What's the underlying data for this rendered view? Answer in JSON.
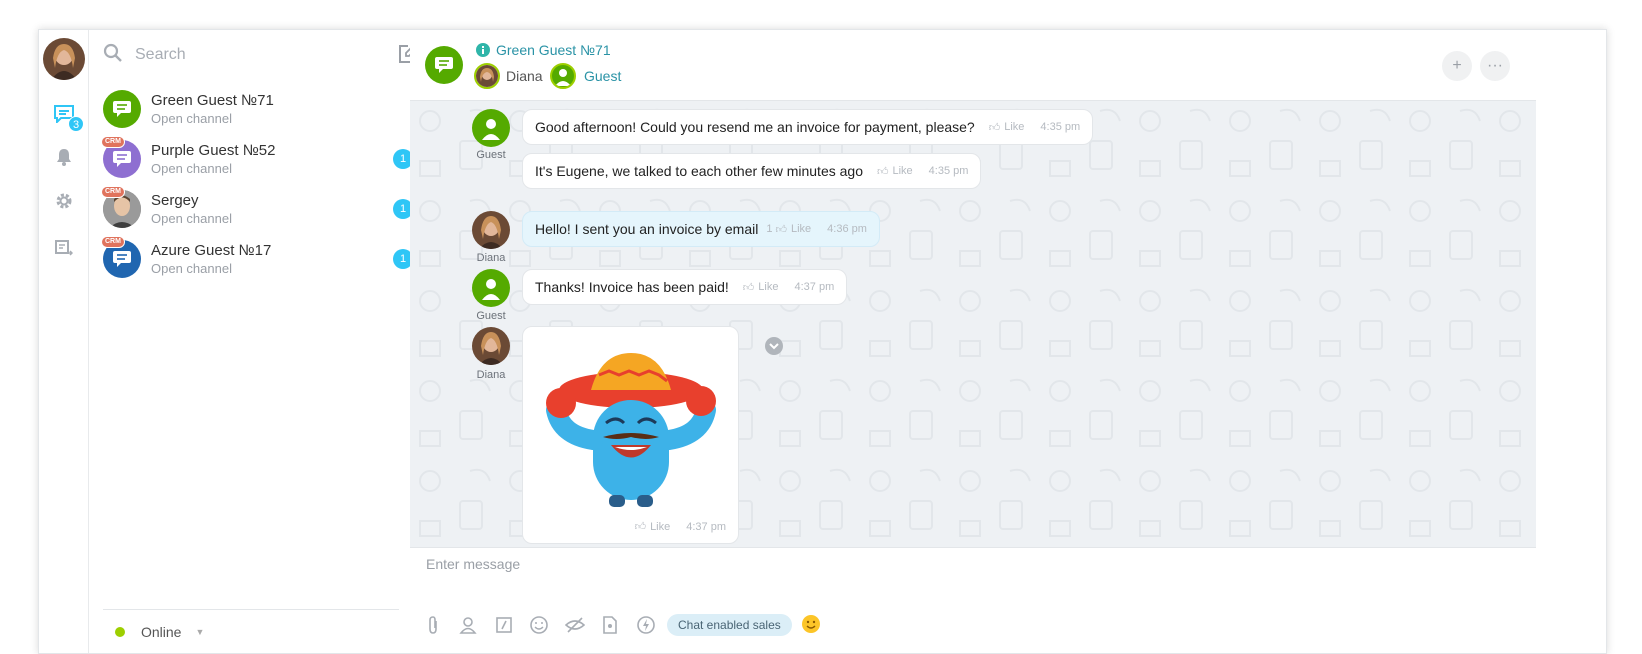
{
  "rail": {
    "chat_badge": "3",
    "icons": [
      "chat-icon",
      "bell-icon",
      "gear-icon",
      "exit-icon"
    ]
  },
  "search": {
    "placeholder": "Search"
  },
  "recent": [
    {
      "name": "Green Guest №71",
      "sub": "Open channel",
      "color": "#55aa00",
      "crm": false,
      "count": ""
    },
    {
      "name": "Purple Guest №52",
      "sub": "Open channel",
      "color": "#8e6fd1",
      "crm": true,
      "count": "1"
    },
    {
      "name": "Sergey",
      "sub": "Open channel",
      "color": "#8a8a8a",
      "crm": true,
      "count": "1"
    },
    {
      "name": "Azure Guest №17",
      "sub": "Open channel",
      "color": "#2066b0",
      "crm": true,
      "count": "1"
    }
  ],
  "status": {
    "label": "Online"
  },
  "header": {
    "title": "Green Guest №71",
    "users": [
      {
        "name": "Diana"
      },
      {
        "name": "Guest"
      }
    ]
  },
  "messages": [
    {
      "author": "Guest",
      "text": "Good afternoon! Could you resend me an invoice for payment, please?",
      "like": "Like",
      "time": "4:35 pm"
    },
    {
      "author": "",
      "text": "It's Eugene, we talked to each other few minutes ago",
      "like": "Like",
      "time": "4:35 pm"
    },
    {
      "author": "Diana",
      "text": "Hello! I sent you an invoice by email",
      "like_count": "1",
      "like": "Like",
      "time": "4:36 pm"
    },
    {
      "author": "Guest",
      "text": "Thanks! Invoice has been paid!",
      "like": "Like",
      "time": "4:37 pm"
    },
    {
      "author": "Diana",
      "sticker": true,
      "like": "Like",
      "time": "4:37 pm"
    }
  ],
  "composer": {
    "placeholder": "Enter message",
    "sales_label": "Chat enabled sales"
  },
  "colors": {
    "accent": "#2fc6f6",
    "green": "#55aa00",
    "link": "#2a93a6"
  }
}
